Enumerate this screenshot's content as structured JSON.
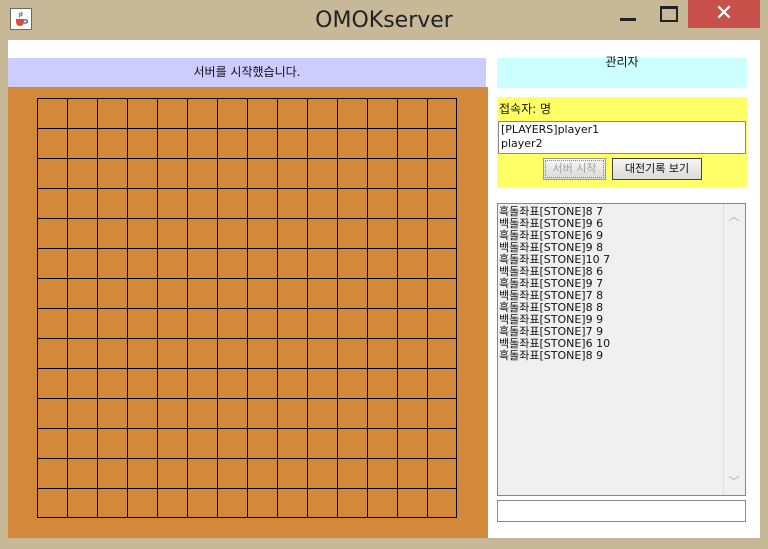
{
  "window": {
    "title": "OMOKserver",
    "close_glyph": "✕",
    "icon": "java-cup-icon"
  },
  "board_panel": {
    "status": "서버를 시작했습니다.",
    "grid_size": 14
  },
  "admin_label": "관리자",
  "connection": {
    "label": "접속자: 명",
    "players": [
      "[PLAYERS]player1",
      "player2"
    ]
  },
  "buttons": {
    "start": "서버 시작",
    "history": "대전기록 보기"
  },
  "log": {
    "lines": [
      "흑돌좌표[STONE]8 7",
      "백돌좌표[STONE]9 6",
      "흑돌좌표[STONE]6 9",
      "백돌좌표[STONE]9 8",
      "흑돌좌표[STONE]10 7",
      "백돌좌표[STONE]8 6",
      "흑돌좌표[STONE]9 7",
      "백돌좌표[STONE]7 8",
      "흑돌좌표[STONE]8 8",
      "백돌좌표[STONE]9 9",
      "흑돌좌표[STONE]7 9",
      "백돌좌표[STONE]6 10",
      "흑돌좌표[STONE]8 9"
    ]
  },
  "input": {
    "value": ""
  },
  "colors": {
    "board": "#d4893a",
    "status_bg": "#ccccff",
    "admin_bg": "#ccffff",
    "panel_bg": "#ffff66",
    "close_red": "#c7504a"
  }
}
